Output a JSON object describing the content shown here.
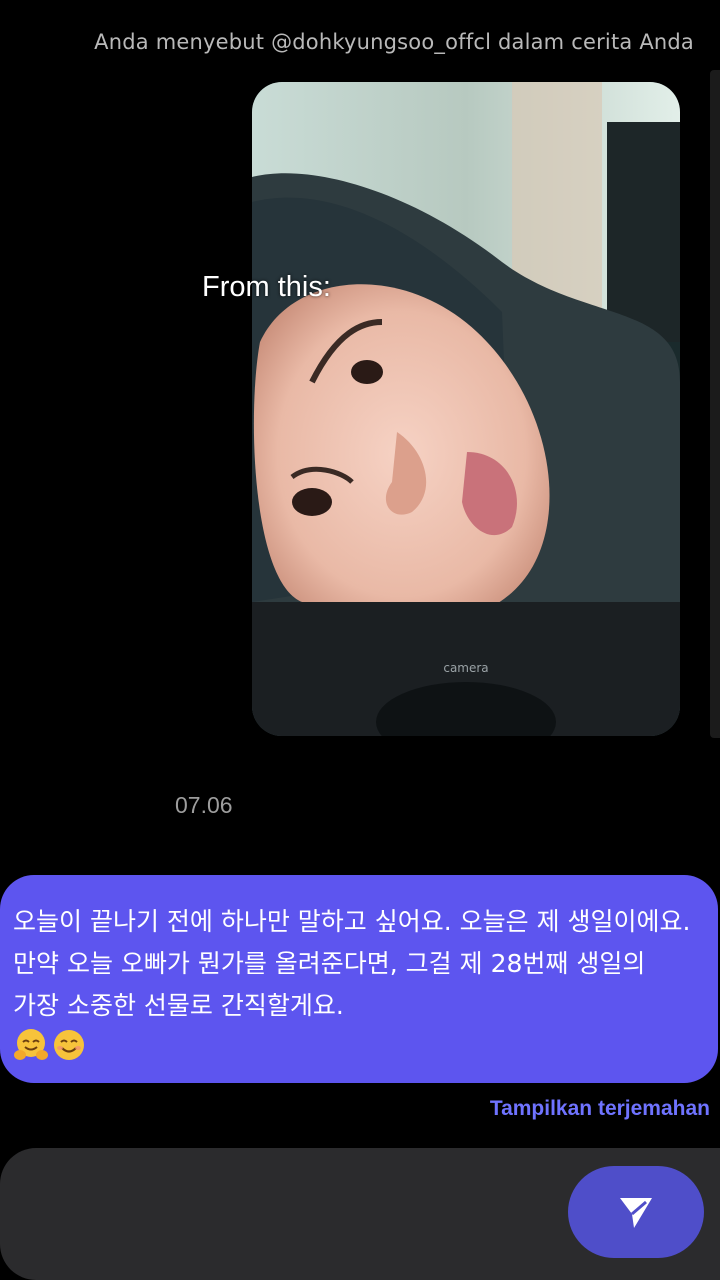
{
  "header": {
    "mention_text": "Anda menyebut @dohkyungsoo_offcl dalam cerita Anda"
  },
  "story": {
    "photo_label": "camera",
    "overlay_caption": "From this:"
  },
  "thread": {
    "date": "07.06",
    "message": {
      "text": "오늘이 끝나기 전에 하나만 말하고 싶어요. 오늘은 제 생일이에요. 만약 오늘 오빠가 뭔가를 올려준다면, 그걸 제 28번째 생일의 가장 소중한 선물로 간직할게요.",
      "emojis": [
        "hugging-face-icon",
        "smiling-face-icon"
      ]
    },
    "translate_link": "Tampilkan terjemahan"
  },
  "composer": {
    "placeholder": "",
    "send_icon": "send-icon"
  },
  "colors": {
    "background": "#000000",
    "bubble": "#5d55ef",
    "link": "#6f73ff",
    "composer": "#2b2b2d",
    "send_button": "#4f4ec9"
  }
}
